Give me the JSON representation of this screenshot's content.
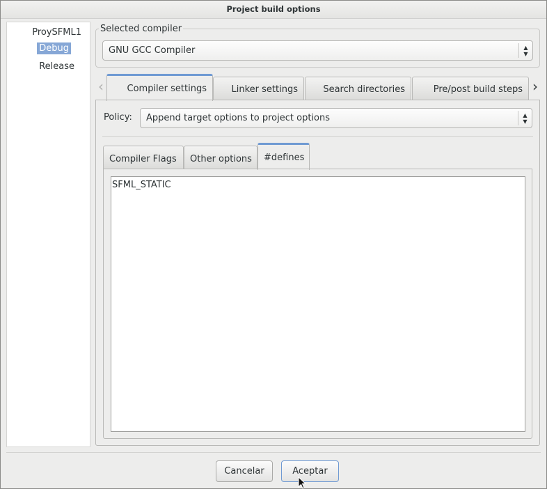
{
  "window": {
    "title": "Project build options"
  },
  "tree": {
    "items": [
      {
        "label": "ProySFML1"
      },
      {
        "label": "Debug",
        "selected": true
      },
      {
        "label": "Release"
      }
    ]
  },
  "compiler": {
    "group_label": "Selected compiler",
    "selected": "GNU GCC Compiler"
  },
  "outer_tabs": [
    {
      "label": "Compiler settings",
      "active": true
    },
    {
      "label": "Linker settings"
    },
    {
      "label": "Search directories"
    },
    {
      "label": "Pre/post build steps"
    }
  ],
  "policy": {
    "label": "Policy:",
    "selected": "Append target options to project options"
  },
  "inner_tabs": [
    {
      "label": "Compiler Flags"
    },
    {
      "label": "Other options"
    },
    {
      "label": "#defines",
      "active": true
    }
  ],
  "defines_text": "SFML_STATIC",
  "buttons": {
    "cancel": "Cancelar",
    "ok": "Aceptar"
  },
  "colors": {
    "selection": "#86a7d6",
    "tab_accent": "#6f9ad3",
    "window_bg": "#ededec"
  }
}
